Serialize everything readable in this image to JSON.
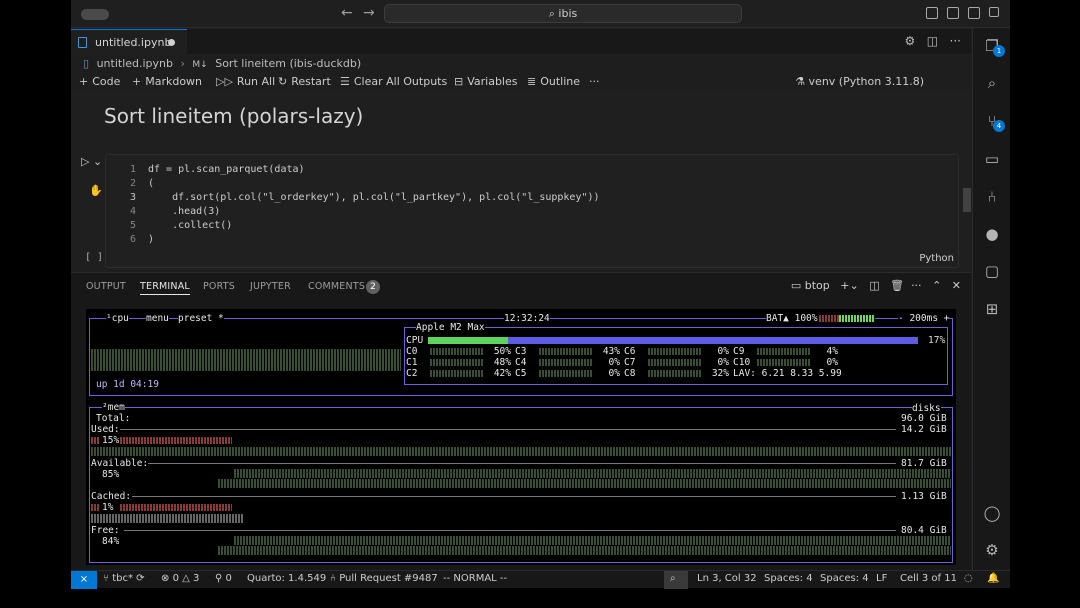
{
  "titlebar": {
    "search": "ibis",
    "back_icon": "arrow-left-icon",
    "forward_icon": "arrow-right-icon"
  },
  "tab": {
    "label": "untitled.ipynb"
  },
  "breadcrumb": {
    "file": "untitled.ipynb",
    "md_prefix": "M↓",
    "section": "Sort lineitem (ibis-duckdb)"
  },
  "toolbar": {
    "code": "Code",
    "markdown": "Markdown",
    "run_all": "Run All",
    "restart": "Restart",
    "clear": "Clear All Outputs",
    "variables": "Variables",
    "outline": "Outline",
    "more": "···",
    "kernel": "venv (Python 3.11.8)"
  },
  "notebook": {
    "heading": "Sort lineitem (polars-lazy)",
    "language": "Python",
    "lines": [
      {
        "n": "1",
        "text": "df = pl.scan_parquet(data)"
      },
      {
        "n": "2",
        "text": "("
      },
      {
        "n": "3",
        "text": "    df.sort(pl.col(\"l_orderkey\"), pl.col(\"l_partkey\"), pl.col(\"l_suppkey\"))"
      },
      {
        "n": "4",
        "text": "    .head(3)"
      },
      {
        "n": "5",
        "text": "    .collect()"
      },
      {
        "n": "6",
        "text": ")"
      }
    ],
    "bracket": "[ ]"
  },
  "panel": {
    "tabs": [
      "OUTPUT",
      "TERMINAL",
      "PORTS",
      "JUPYTER",
      "COMMENTS"
    ],
    "comments_count": "2",
    "terminal_name": "btop"
  },
  "btop": {
    "cpu_label": "¹cpu",
    "menu": "menu",
    "preset": "preset *",
    "clock": "12:32:24",
    "battery": "BAT▲ 100%",
    "interval": "- 200ms +",
    "model": "Apple M2 Max",
    "cpu_total_label": "CPU",
    "cpu_total": "17%",
    "cores_col1": [
      "C0",
      "C1",
      "C2"
    ],
    "cores_col1_pct": [
      "50%",
      "48%",
      "42%"
    ],
    "cores_col2": [
      "C3",
      "C4",
      "C5"
    ],
    "cores_col2_pct": [
      "43%",
      "0%",
      "0%"
    ],
    "cores_col3": [
      "C6",
      "C7",
      "C8"
    ],
    "cores_col3_pct": [
      "0%",
      "0%",
      "32%"
    ],
    "cores_col4": [
      "C9",
      "C10"
    ],
    "cores_col4_pct": [
      "4%",
      "0%"
    ],
    "lav": "LAV: 6.21 8.33 5.99",
    "uptime": "up 1d 04:19",
    "mem_label": "²mem",
    "disks_label": "disks",
    "total_label": "Total:",
    "total": "96.0 GiB",
    "used_label": "Used:",
    "used": "14.2 GiB",
    "used_pct": "15%",
    "available_label": "Available:",
    "available": "81.7 GiB",
    "available_pct": "85%",
    "cached_label": "Cached:",
    "cached": "1.13 GiB",
    "cached_pct": "1%",
    "free_label": "Free:",
    "free": "80.4 GiB",
    "free_pct": "84%"
  },
  "status": {
    "branch": "tbc*",
    "errors": "0",
    "warnings": "3",
    "ports": "0",
    "quarto": "Quarto: 1.4.549",
    "pr": "Pull Request #9487",
    "mode": "-- NORMAL --",
    "position": "Ln 3, Col 32",
    "spaces1": "Spaces: 4",
    "spaces2": "Spaces: 4",
    "eol": "LF",
    "cell": "Cell 3 of 11"
  },
  "activity_badges": {
    "explorer": "1",
    "scm": "4"
  },
  "colors": {
    "accent": "#0078d4",
    "btop_border": "#6f5fd6",
    "cpu_bar": "#5fd35f"
  }
}
